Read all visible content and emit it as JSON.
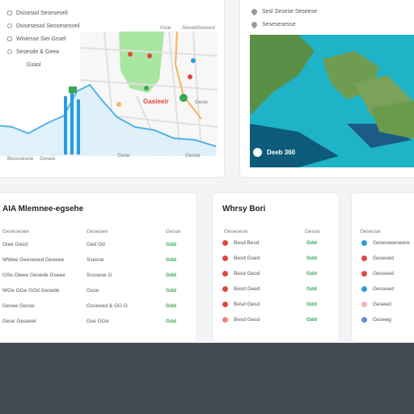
{
  "top_left_card": {
    "legend": [
      {
        "label": "Dsisesiol Sesesesell",
        "icon": "grid-icon"
      },
      {
        "label": "Dsisesesiol Seosesesseil",
        "icon": "gear-icon"
      },
      {
        "label": "Wisiesse Siei Gssel",
        "icon": "hexagon-icon"
      },
      {
        "label": "Sesesde & Geea",
        "icon": "settings-icon"
      },
      {
        "label": "Gsiiol",
        "icon": "globe-icon"
      }
    ],
    "map_labels": {
      "top": [
        "Gsie",
        "Sesee",
        "Sessesl"
      ],
      "place": "Gasieeir",
      "side": "Geoe"
    },
    "footer_labels": [
      "Besesesne",
      "Gesee",
      "Gsoe",
      "Gesse"
    ],
    "colors": {
      "chart_line": "#4fb3e6",
      "bar": "#2a9be0",
      "park": "#9be39b",
      "pin_red": "#e0483a"
    }
  },
  "top_right_card": {
    "legend": [
      {
        "label": "Sesl Sesese Seseese",
        "icon": "pin-icon"
      },
      {
        "label": "Sesesesesse",
        "icon": "pin-icon"
      }
    ],
    "caption": "Deeb 360"
  },
  "table_card": {
    "title": "AIA Mlemnee-egsehe",
    "headers": [
      "Gesesesee",
      "Gesesee",
      "Gesse"
    ],
    "rows": [
      {
        "name": "Giee Gesd",
        "value": "Ged Gd",
        "status": "Gdd"
      },
      {
        "name": "WWee Geeseeed Geoeee",
        "value": "Ssesse",
        "status": "Gdd"
      },
      {
        "name": "GSe Gleee Gesede Gseee",
        "value": "Ssssese G",
        "status": "Gdd"
      },
      {
        "name": "WGe GGe GGd Gesede",
        "value": "Gsse",
        "status": "Gdd"
      },
      {
        "name": "Gesee Gesse",
        "value": "Gsseeed & GG G",
        "status": "Gdd"
      },
      {
        "name": "Gese Geseeel",
        "value": "Gse GGe",
        "status": "Gdd"
      }
    ]
  },
  "mid_card": {
    "title": "Whrsy Bori",
    "headers": [
      "Gesesese",
      "Gesse"
    ],
    "rows": [
      {
        "name": "Besd Besd",
        "status": "Gdd",
        "color": "#e0483a"
      },
      {
        "name": "Besd Gsed",
        "status": "Gdd",
        "color": "#e0483a"
      },
      {
        "name": "Besd Geod",
        "status": "Gdd",
        "color": "#e0483a"
      },
      {
        "name": "Besd Geed",
        "status": "Gdd",
        "color": "#e0483a"
      },
      {
        "name": "Besd Gesd",
        "status": "Gdd",
        "color": "#e0483a"
      },
      {
        "name": "Besd Gesd",
        "status": "Gdd",
        "color": "#f08080"
      }
    ]
  },
  "right_card": {
    "headers": [
      "Gesesse"
    ],
    "rows": [
      {
        "name": "Geseseeeseere",
        "color": "#2a9be0"
      },
      {
        "name": "Gesesed",
        "color": "#e0483a"
      },
      {
        "name": "Gesseed",
        "color": "#e0483a"
      },
      {
        "name": "Gesseed",
        "color": "#2a9be0"
      },
      {
        "name": "Geseed",
        "color": "#f5b3b3"
      },
      {
        "name": "Geseeg",
        "color": "#5b8fd6"
      }
    ]
  }
}
